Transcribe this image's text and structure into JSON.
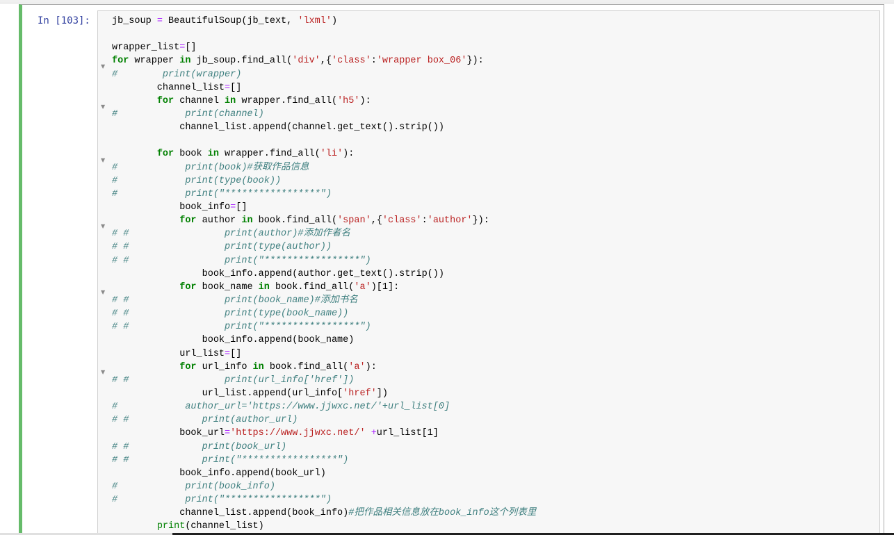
{
  "cell": {
    "prompt": "In [103]:",
    "lines": [
      [
        [
          "",
          "jb_soup "
        ],
        [
          "op",
          "="
        ],
        [
          "",
          " BeautifulSoup(jb_text, "
        ],
        [
          "str",
          "'lxml'"
        ],
        [
          "",
          ")"
        ]
      ],
      [],
      [
        [
          "",
          "wrapper_list"
        ],
        [
          "op",
          "="
        ],
        [
          "",
          "[]"
        ]
      ],
      [
        [
          "kw",
          "for"
        ],
        [
          "",
          " wrapper "
        ],
        [
          "kw",
          "in"
        ],
        [
          "",
          " jb_soup.find_all("
        ],
        [
          "str",
          "'div'"
        ],
        [
          "",
          ",{"
        ],
        [
          "str",
          "'class'"
        ],
        [
          "",
          ":"
        ],
        [
          "str",
          "'wrapper box_06'"
        ],
        [
          "",
          "}):"
        ]
      ],
      [
        [
          "cmt",
          "#        print(wrapper)"
        ]
      ],
      [
        [
          "",
          "        channel_list"
        ],
        [
          "op",
          "="
        ],
        [
          "",
          "[]"
        ]
      ],
      [
        [
          "",
          "        "
        ],
        [
          "kw",
          "for"
        ],
        [
          "",
          " channel "
        ],
        [
          "kw",
          "in"
        ],
        [
          "",
          " wrapper.find_all("
        ],
        [
          "str",
          "'h5'"
        ],
        [
          "",
          "):"
        ]
      ],
      [
        [
          "cmt",
          "#            print(channel)"
        ]
      ],
      [
        [
          "",
          "            channel_list.append(channel.get_text().strip())"
        ]
      ],
      [],
      [
        [
          "",
          "        "
        ],
        [
          "kw",
          "for"
        ],
        [
          "",
          " book "
        ],
        [
          "kw",
          "in"
        ],
        [
          "",
          " wrapper.find_all("
        ],
        [
          "str",
          "'li'"
        ],
        [
          "",
          "):"
        ]
      ],
      [
        [
          "cmt",
          "#            print(book)#获取作品信息"
        ]
      ],
      [
        [
          "cmt",
          "#            print(type(book))"
        ]
      ],
      [
        [
          "cmt",
          "#            print(\"*****************\")"
        ]
      ],
      [
        [
          "",
          "            book_info"
        ],
        [
          "op",
          "="
        ],
        [
          "",
          "[]"
        ]
      ],
      [
        [
          "",
          "            "
        ],
        [
          "kw",
          "for"
        ],
        [
          "",
          " author "
        ],
        [
          "kw",
          "in"
        ],
        [
          "",
          " book.find_all("
        ],
        [
          "str",
          "'span'"
        ],
        [
          "",
          ",{"
        ],
        [
          "str",
          "'class'"
        ],
        [
          "",
          ":"
        ],
        [
          "str",
          "'author'"
        ],
        [
          "",
          "}):"
        ]
      ],
      [
        [
          "cmt",
          "# #                 print(author)#添加作者名"
        ]
      ],
      [
        [
          "cmt",
          "# #                 print(type(author))"
        ]
      ],
      [
        [
          "cmt",
          "# #                 print(\"*****************\")"
        ]
      ],
      [
        [
          "",
          "                book_info.append(author.get_text().strip())"
        ]
      ],
      [
        [
          "",
          "            "
        ],
        [
          "kw",
          "for"
        ],
        [
          "",
          " book_name "
        ],
        [
          "kw",
          "in"
        ],
        [
          "",
          " book.find_all("
        ],
        [
          "str",
          "'a'"
        ],
        [
          "",
          ")[1]:"
        ]
      ],
      [
        [
          "cmt",
          "# #                 print(book_name)#添加书名"
        ]
      ],
      [
        [
          "cmt",
          "# #                 print(type(book_name))"
        ]
      ],
      [
        [
          "cmt",
          "# #                 print(\"*****************\")"
        ]
      ],
      [
        [
          "",
          "                book_info.append(book_name)"
        ]
      ],
      [
        [
          "",
          "            url_list"
        ],
        [
          "op",
          "="
        ],
        [
          "",
          "[]"
        ]
      ],
      [
        [
          "",
          "            "
        ],
        [
          "kw",
          "for"
        ],
        [
          "",
          " url_info "
        ],
        [
          "kw",
          "in"
        ],
        [
          "",
          " book.find_all("
        ],
        [
          "str",
          "'a'"
        ],
        [
          "",
          "):"
        ]
      ],
      [
        [
          "cmt",
          "# #                 print(url_info['href'])"
        ]
      ],
      [
        [
          "",
          "                url_list.append(url_info["
        ],
        [
          "str",
          "'href'"
        ],
        [
          "",
          "])"
        ]
      ],
      [
        [
          "cmt",
          "#            author_url='https://www.jjwxc.net/'+url_list[0]"
        ]
      ],
      [
        [
          "cmt",
          "# #             print(author_url)"
        ]
      ],
      [
        [
          "",
          "            book_url"
        ],
        [
          "op",
          "="
        ],
        [
          "str",
          "'https://www.jjwxc.net/'"
        ],
        [
          "",
          " "
        ],
        [
          "op",
          "+"
        ],
        [
          "",
          "url_list[1]"
        ]
      ],
      [
        [
          "cmt",
          "# #             print(book_url)"
        ]
      ],
      [
        [
          "cmt",
          "# #             print(\"*****************\")"
        ]
      ],
      [
        [
          "",
          "            book_info.append(book_url)"
        ]
      ],
      [
        [
          "cmt",
          "#            print(book_info)"
        ]
      ],
      [
        [
          "cmt",
          "#            print(\"*****************\")"
        ]
      ],
      [
        [
          "",
          "            channel_list.append(book_info)"
        ],
        [
          "cmt",
          "#把作品相关信息放在book_info这个列表里"
        ]
      ],
      [
        [
          "",
          "        "
        ],
        [
          "bi",
          "print"
        ],
        [
          "",
          "(channel_list)"
        ]
      ]
    ],
    "fold_markers": [
      "▼",
      "▼",
      "▼",
      "▼",
      "▼",
      "▼"
    ]
  }
}
